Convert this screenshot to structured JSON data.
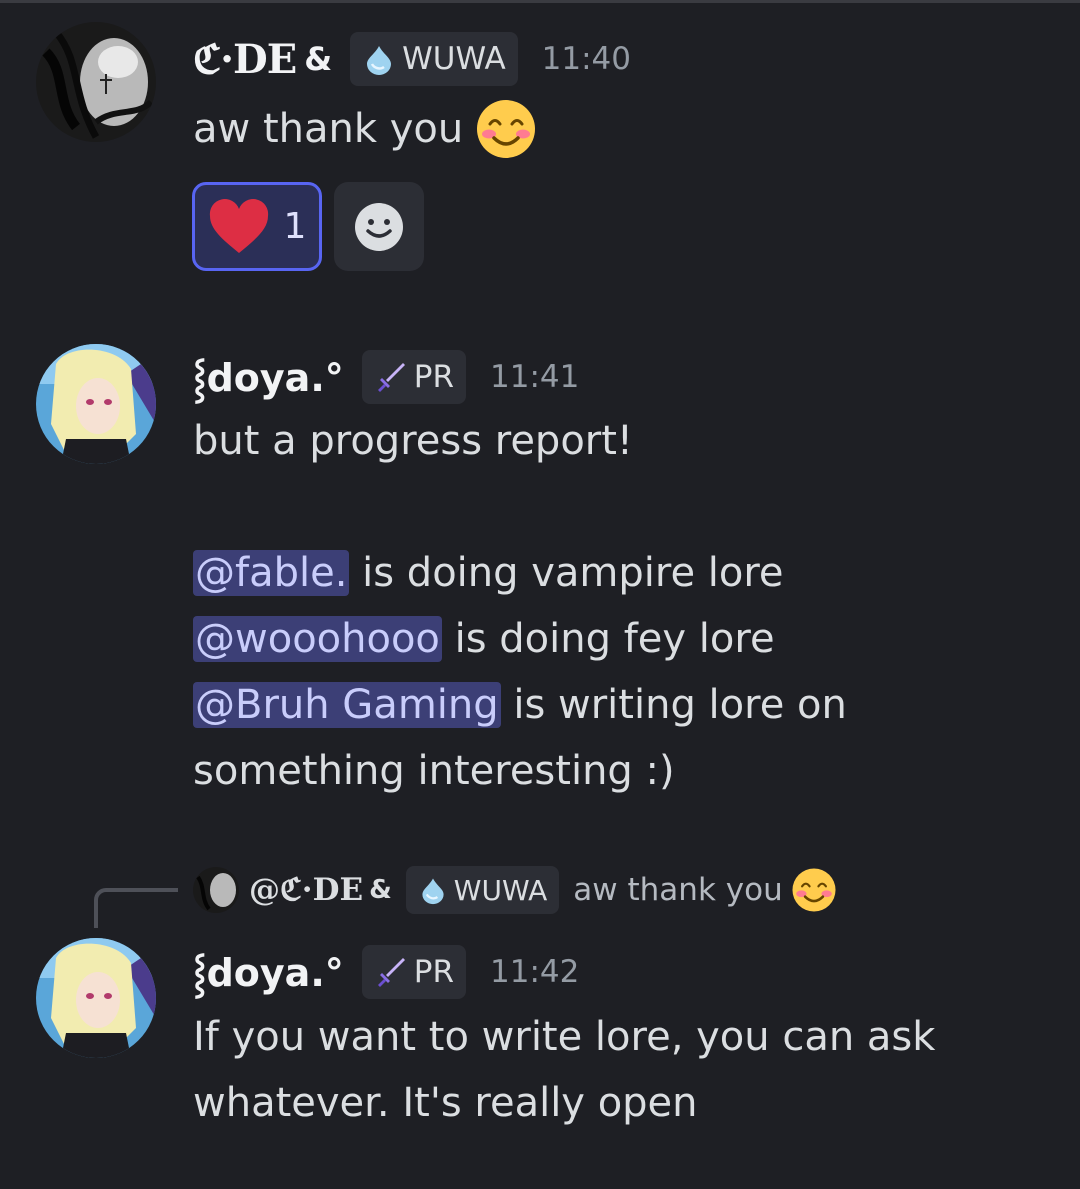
{
  "messages": [
    {
      "username": "ℭ·DE",
      "username_suffix": "&",
      "tag": {
        "icon": "water-drop-icon",
        "label": "WUWA"
      },
      "time": "11:40",
      "text": "aw thank you",
      "emoji": "smiling-face-icon",
      "reactions": [
        {
          "emoji": "heart-icon",
          "count": "1",
          "active": true
        }
      ]
    },
    {
      "username": "⸾doya.°",
      "tag": {
        "icon": "sword-icon",
        "label": "PR"
      },
      "time": "11:41",
      "lines": [
        {
          "text": "but a progress report!"
        },
        {
          "text": ""
        },
        {
          "mention": "@fable.",
          "text": " is doing vampire lore"
        },
        {
          "mention": "@wooohooo",
          "text": " is doing fey lore"
        },
        {
          "mention": "@Bruh Gaming",
          "text": " is writing lore on"
        },
        {
          "text": "something interesting :)"
        }
      ]
    },
    {
      "reply": {
        "username": "@ℭ·DE",
        "username_suffix": "&",
        "tag": {
          "icon": "water-drop-icon",
          "label": "WUWA"
        },
        "text": "aw thank you"
      },
      "username": "⸾doya.°",
      "tag": {
        "icon": "sword-icon",
        "label": "PR"
      },
      "time": "11:42",
      "lines": [
        {
          "text": "If you want to write lore, you can ask"
        },
        {
          "text": "whatever. It's really open"
        }
      ]
    }
  ],
  "colors": {
    "background": "#1e1f24",
    "mention_bg": "#3c3f76",
    "mention_text": "#c9cdfb",
    "reaction_border": "#5865f2",
    "timestamp": "#949ba4"
  }
}
